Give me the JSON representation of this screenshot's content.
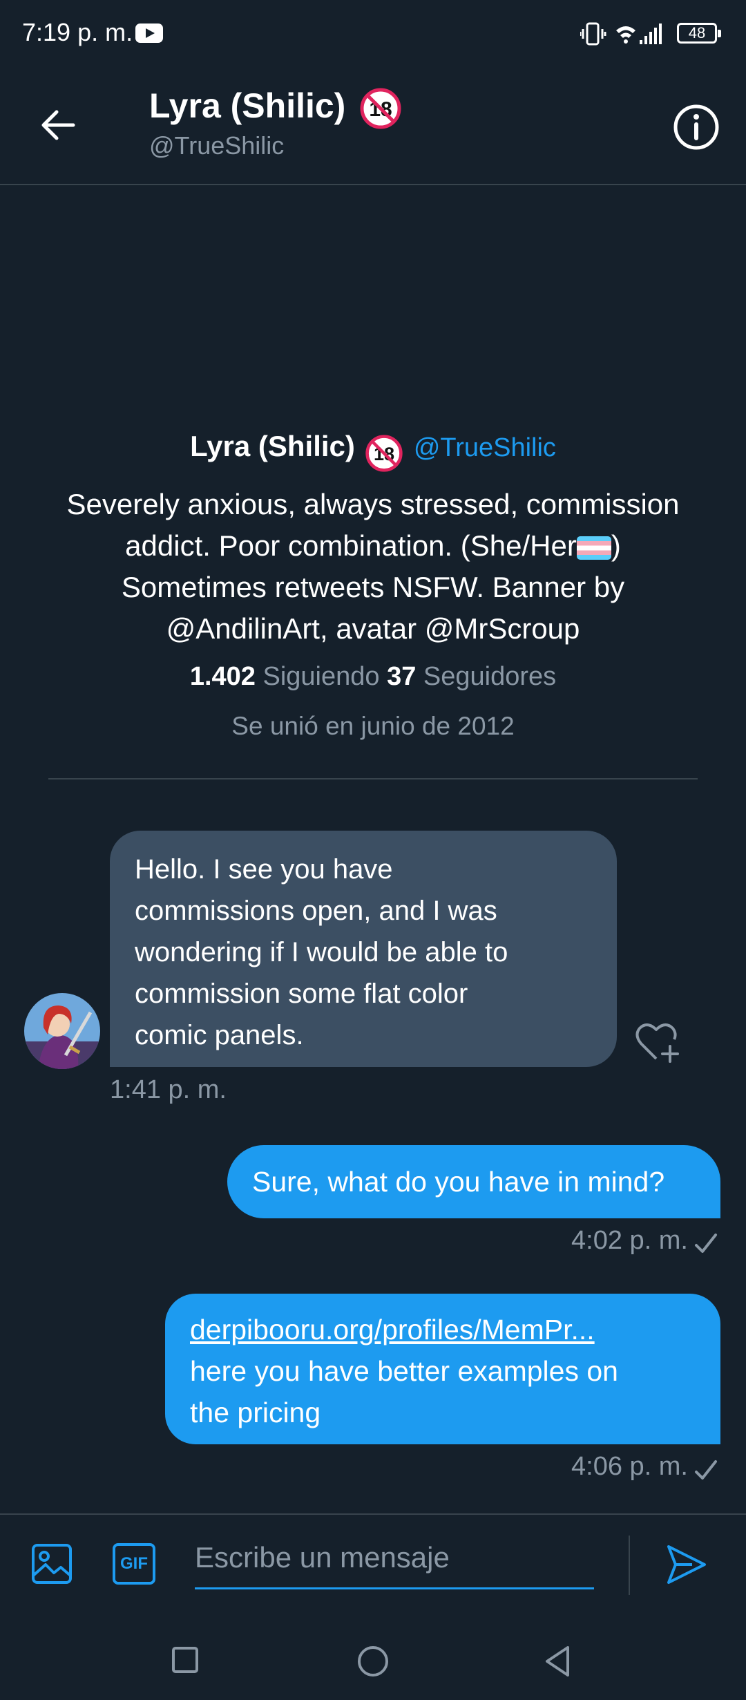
{
  "status_bar": {
    "time": "7:19 p. m.",
    "battery": "48",
    "icons": [
      "youtube-notification-icon",
      "vibrate-icon",
      "wifi-icon",
      "signal-icon",
      "battery-icon"
    ]
  },
  "header": {
    "name": "Lyra (Shilic)",
    "handle": "@TrueShilic",
    "back_icon": "arrow-left-icon",
    "info_icon": "info-icon"
  },
  "profile": {
    "name": "Lyra (Shilic)",
    "handle": "@TrueShilic",
    "bio_line1": "Severely anxious, always stressed, commission",
    "bio_line2": "addict. Poor combination. (She/Her",
    "bio_line2_end": ")",
    "bio_line3": "Sometimes retweets NSFW. Banner by",
    "bio_line4": "@AndilinArt, avatar @MrScroup",
    "following_count": "1.402",
    "following_label": "Siguiendo",
    "followers_count": "37",
    "followers_label": "Seguidores",
    "joined": "Se unió en junio de 2012"
  },
  "messages": [
    {
      "direction": "incoming",
      "lines": [
        "Hello. I see you have",
        "commissions open, and I was",
        "wondering if I would be able to",
        "commission some flat color",
        "comic panels."
      ],
      "time": "1:41 p. m."
    },
    {
      "direction": "outgoing",
      "text": "Sure, what do you have in mind?",
      "time": "4:02 p. m."
    },
    {
      "direction": "outgoing",
      "link": "derpibooru.org/profiles/MemPr...",
      "lines": [
        "here you have better examples on",
        "the pricing"
      ],
      "time": "4:06 p. m."
    }
  ],
  "composer": {
    "placeholder": "Escribe un mensaje",
    "gif_label": "GIF"
  },
  "colors": {
    "background": "#15202b",
    "accent": "#1d9bf0",
    "incoming_bubble": "#3c4f63",
    "secondary_text": "#8b98a5",
    "divider": "#38444d"
  }
}
